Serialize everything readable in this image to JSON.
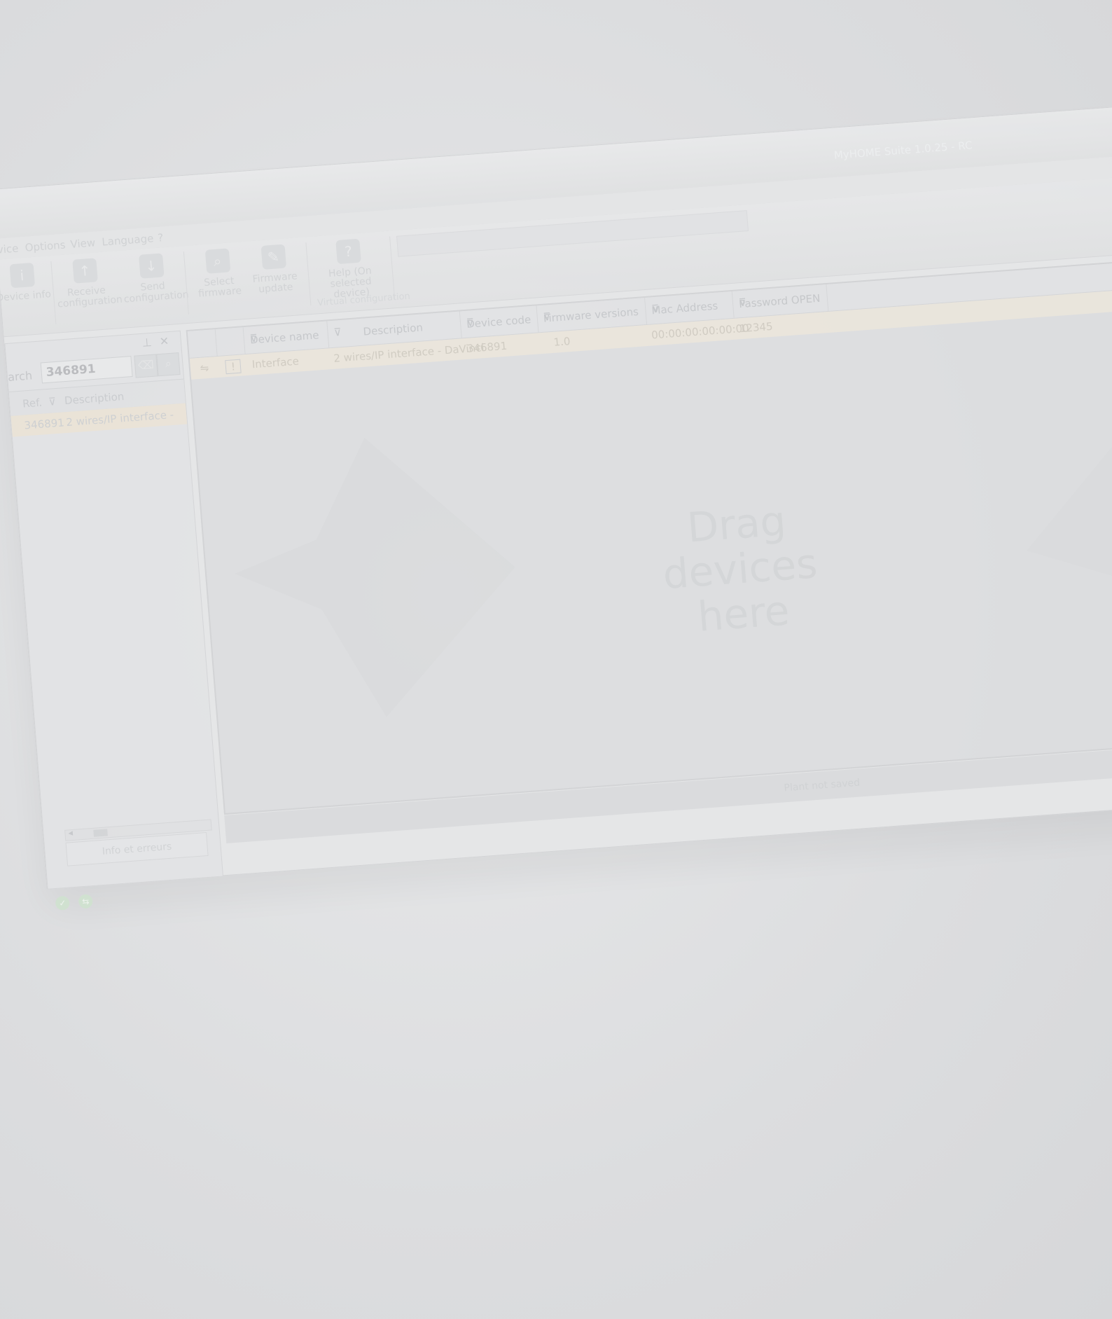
{
  "window": {
    "app_title": "MyHOME Suite 1.0.25 - RC"
  },
  "menu": [
    "vice",
    "Options",
    "View",
    "Language",
    "?"
  ],
  "ribbon": {
    "buttons": [
      {
        "label": "Device info",
        "icon": "info-icon"
      },
      {
        "label": "Receive configuration",
        "icon": "receive-icon"
      },
      {
        "label": "Send configuration",
        "icon": "send-icon"
      },
      {
        "label": "Select firmware",
        "icon": "search-icon"
      },
      {
        "label": "Firmware update",
        "icon": "firmware-icon"
      },
      {
        "label": "Help (On selected device)",
        "icon": "help-icon"
      }
    ],
    "group_label": "Virtual configuration"
  },
  "catalog": {
    "search_label": "arch",
    "search_value": "346891",
    "columns": [
      "Ref.",
      "Description"
    ],
    "rows": [
      {
        "ref": "346891",
        "description": "2 wires/IP interface -"
      }
    ],
    "bottom_tab": "Info et erreurs"
  },
  "devices_table": {
    "columns": [
      "Device name",
      "Description",
      "Device code",
      "Firmware versions",
      "Mac Address",
      "Password OPEN"
    ],
    "rows": [
      {
        "device_name": "Interface",
        "description": "2 wires/IP interface - DaVinci",
        "device_code": "346891",
        "firmware": "1.0",
        "mac": "00:00:00:00:00:00",
        "password": "12345"
      }
    ],
    "drop_hint_1": "Drag",
    "drop_hint_2": "devices",
    "drop_hint_3": "here"
  },
  "status": {
    "text": "Plant not saved"
  }
}
